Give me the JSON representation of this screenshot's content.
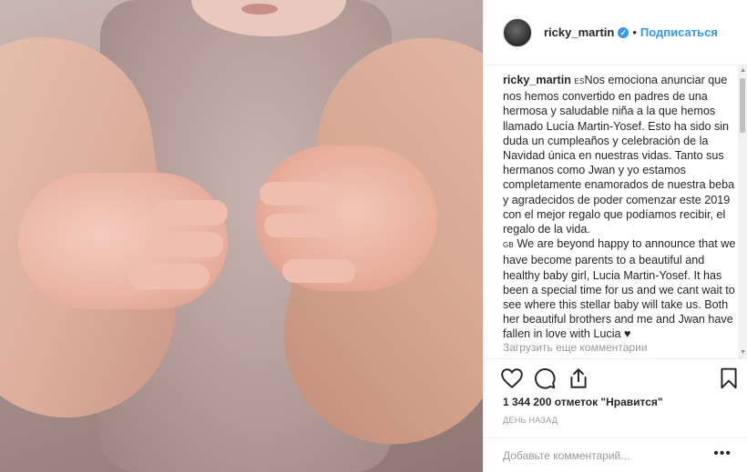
{
  "post": {
    "username": "ricky_martin",
    "follow_label": "Подписаться",
    "caption": {
      "author": "ricky_martin",
      "es_flag": "ES",
      "es_text": "Nos emociona anunciar que nos hemos convertido en padres de una hermosa y saludable niña a la que hemos llamado Lucía Martin-Yosef. Esto ha sido sin duda un cumpleaños y celebración de la Navidad única en nuestras vidas. Tanto sus hermanos como Jwan y yo estamos completamente enamorados de nuestra beba y agradecidos de poder comenzar este 2019 con el mejor regalo que podíamos recibir, el regalo de la vida.",
      "gb_flag": "GB",
      "gb_text": "We are beyond happy to announce that we have become parents to a beautiful and healthy baby girl, Lucia Martin-Yosef. It has been a special time for us and we cant wait to see where this stellar baby will take us. Both her beautiful brothers and me and Jwan have fallen in love with Lucia ♥"
    },
    "load_more_label": "Загрузить еще комментарии",
    "likes": "1 344 200 отметок \"Нравится\"",
    "time": "ДЕНЬ НАЗАД",
    "comment_placeholder": "Добавьте комментарий...",
    "more_label": "•••"
  },
  "icons": [
    "heart-icon",
    "comment-icon",
    "share-icon",
    "bookmark-icon",
    "verified-icon"
  ],
  "colors": {
    "link": "#3897f0",
    "muted": "#999999",
    "text": "#262626",
    "border": "#efefef"
  }
}
